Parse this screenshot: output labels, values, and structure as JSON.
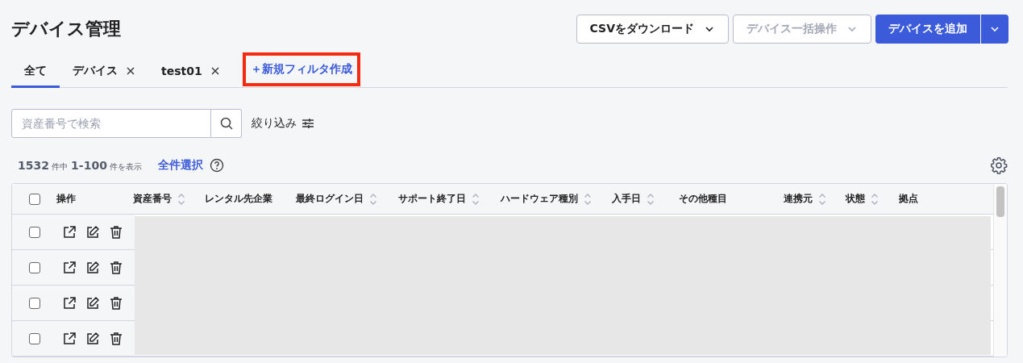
{
  "page_title": "デバイス管理",
  "header_buttons": [
    {
      "kind": "dropdown",
      "label": "CSVをダウンロード",
      "disabled": false
    },
    {
      "kind": "dropdown",
      "label": "デバイス一括操作",
      "disabled": true
    },
    {
      "kind": "split",
      "label": "デバイスを追加",
      "disabled": false
    }
  ],
  "tabs": [
    {
      "label": "全て",
      "selected": true,
      "closable": false
    },
    {
      "label": "デバイス",
      "selected": false,
      "closable": true
    },
    {
      "label": "test01",
      "selected": false,
      "closable": true
    }
  ],
  "new_filter": {
    "label": "＋新規フィルタ作成",
    "highlighted": true
  },
  "search": {
    "placeholder": "資産番号で検索"
  },
  "filter_label": "絞り込み",
  "summary": {
    "total": "1532",
    "total_unit": "件中",
    "range": "1-100",
    "range_unit": "件を表示"
  },
  "select_all": "全件選択",
  "table": {
    "columns": [
      {
        "label": "操作",
        "sortable": false
      },
      {
        "label": "資産番号",
        "sortable": true
      },
      {
        "label": "レンタル先企業",
        "sortable": false
      },
      {
        "label": "最終ログイン日",
        "sortable": true
      },
      {
        "label": "サポート終了日",
        "sortable": true
      },
      {
        "label": "ハードウェア種別",
        "sortable": true
      },
      {
        "label": "入手日",
        "sortable": true
      },
      {
        "label": "その他種目",
        "sortable": false
      },
      {
        "label": "連携元",
        "sortable": true
      },
      {
        "label": "状態",
        "sortable": true
      },
      {
        "label": "拠点",
        "sortable": false
      }
    ],
    "header_checked": false,
    "rows": [
      {
        "checked": false
      },
      {
        "checked": false
      },
      {
        "checked": false
      },
      {
        "checked": false
      }
    ],
    "loading": true
  }
}
